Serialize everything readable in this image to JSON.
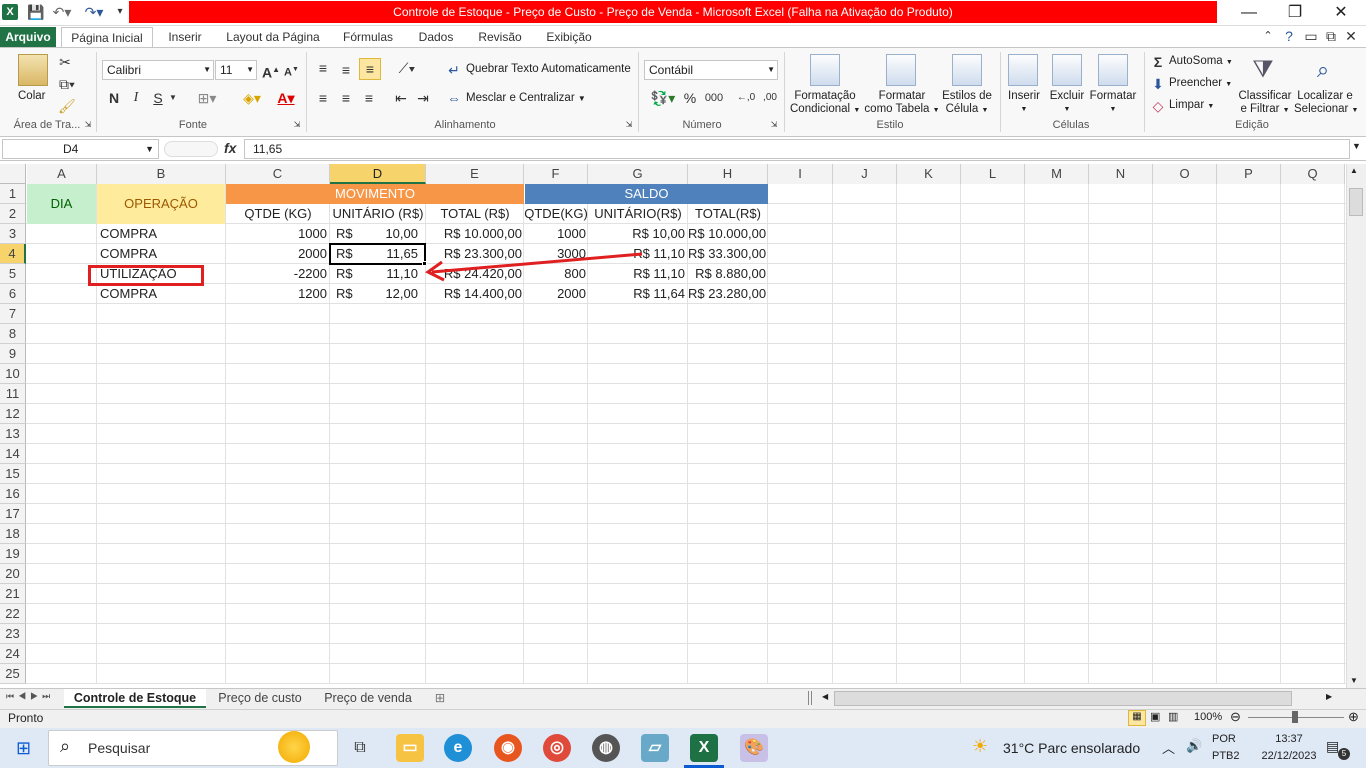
{
  "window": {
    "title": "Controle de Estoque - Preço de Custo - Preço de Venda  -  Microsoft Excel (Falha na Ativação do Produto)",
    "app_icon": "X"
  },
  "ribbon_tabs": [
    "Arquivo",
    "Página Inicial",
    "Inserir",
    "Layout da Página",
    "Fórmulas",
    "Dados",
    "Revisão",
    "Exibição"
  ],
  "ribbon": {
    "clipboard": {
      "paste": "Colar",
      "group": "Área de Tra..."
    },
    "font": {
      "name": "Calibri",
      "size": "11",
      "group": "Fonte",
      "bold": "N",
      "italic": "I",
      "underline": "S"
    },
    "alignment": {
      "wrap": "Quebrar Texto Automaticamente",
      "merge": "Mesclar e Centralizar",
      "group": "Alinhamento"
    },
    "number": {
      "format": "Contábil",
      "group": "Número",
      "percent": "%",
      "thousands": "000"
    },
    "styles": {
      "cond_1": "Formatação",
      "cond_2": "Condicional",
      "table_1": "Formatar",
      "table_2": "como Tabela",
      "cell_1": "Estilos de",
      "cell_2": "Célula",
      "group": "Estilo"
    },
    "cells": {
      "insert": "Inserir",
      "delete": "Excluir",
      "format": "Formatar",
      "group": "Células"
    },
    "editing": {
      "autosum": "AutoSoma",
      "fill": "Preencher",
      "clear": "Limpar",
      "sort_1": "Classificar",
      "sort_2": "e Filtrar",
      "find_1": "Localizar e",
      "find_2": "Selecionar",
      "group": "Edição"
    }
  },
  "formula_bar": {
    "name_box": "D4",
    "fx": "fx",
    "content": "11,65"
  },
  "columns": [
    "A",
    "B",
    "C",
    "D",
    "E",
    "F",
    "G",
    "H",
    "I",
    "J",
    "K",
    "L",
    "M",
    "N",
    "O",
    "P",
    "Q"
  ],
  "rows": [
    "1",
    "2",
    "3",
    "4",
    "5",
    "6",
    "7",
    "8",
    "9",
    "10",
    "11",
    "12",
    "13",
    "14",
    "15",
    "16",
    "17",
    "18",
    "19",
    "20",
    "21",
    "22",
    "23",
    "24",
    "25"
  ],
  "sheet": {
    "header_dia": "DIA",
    "header_operacao": "OPERAÇÃO",
    "header_movimento": "MOVIMENTO",
    "header_saldo": "SALDO",
    "sub_headers": [
      "QTDE (KG)",
      "UNITÁRIO (R$)",
      "TOTAL (R$)",
      "QTDE(KG)",
      "UNITÁRIO(R$)",
      "TOTAL(R$)"
    ],
    "data_rows": [
      {
        "op": "COMPRA",
        "qtde": "1000",
        "cur": "R$",
        "unit": "10,00",
        "total": "R$ 10.000,00",
        "sqtde": "1000",
        "sunit": "R$ 10,00",
        "stotal": "R$ 10.000,00"
      },
      {
        "op": "COMPRA",
        "qtde": "2000",
        "cur": "R$",
        "unit": "11,65",
        "total": "R$ 23.300,00",
        "sqtde": "3000",
        "sunit": "R$ 11,10",
        "stotal": "R$ 33.300,00"
      },
      {
        "op": "UTILIZAÇÃO",
        "qtde": "-2200",
        "cur": "R$",
        "unit": "11,10",
        "total": "R$ 24.420,00",
        "sqtde": "800",
        "sunit": "R$ 11,10",
        "stotal": "R$ 8.880,00"
      },
      {
        "op": "COMPRA",
        "qtde": "1200",
        "cur": "R$",
        "unit": "12,00",
        "total": "R$ 14.400,00",
        "sqtde": "2000",
        "sunit": "R$ 11,64",
        "stotal": "R$ 23.280,00"
      }
    ]
  },
  "sheet_tabs": [
    "Controle de Estoque",
    "Preço de custo",
    "Preço de venda"
  ],
  "status": {
    "ready": "Pronto",
    "zoom": "100%"
  },
  "taskbar": {
    "search": "Pesquisar",
    "weather": "31°C  Parc ensolarado",
    "lang_1": "POR",
    "lang_2": "PTB2",
    "time": "13:37",
    "date": "22/12/2023",
    "notif": "5"
  },
  "colors": {
    "movimento": "#f79646",
    "saldo": "#4f81bd",
    "dia": "#c6efce",
    "operacao": "#ffeb9c",
    "annotation": "#e02020",
    "excel_green": "#217346"
  }
}
